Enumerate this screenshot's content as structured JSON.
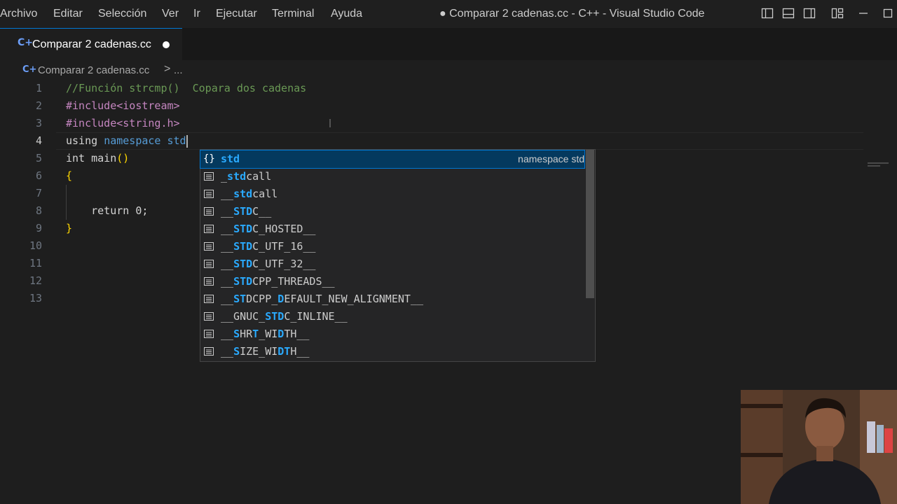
{
  "menubar": {
    "items": [
      "Archivo",
      "Editar",
      "Selección",
      "Ver",
      "Ir",
      "Ejecutar",
      "Terminal",
      "Ayuda"
    ],
    "title": "● Comparar 2 cadenas.cc - C++ - Visual Studio Code"
  },
  "tab": {
    "icon": "cpp-file-icon",
    "label": "Comparar 2 cadenas.cc",
    "unsaved": true
  },
  "breadcrumb": {
    "file": "Comparar 2 cadenas.cc",
    "separator": ">",
    "rest": "..."
  },
  "editor": {
    "line_numbers": [
      "1",
      "2",
      "3",
      "4",
      "5",
      "6",
      "7",
      "8",
      "9",
      "10",
      "11",
      "12",
      "13"
    ],
    "active_line": 4,
    "lines": [
      "//Función strcmp()  Copara dos cadenas",
      "#include<iostream>",
      "#include<string.h>",
      "using namespace std",
      "int main()",
      "{",
      "",
      "    return 0;",
      "}"
    ]
  },
  "suggest": {
    "items": [
      {
        "pre": "",
        "match": "std",
        "post": "",
        "kind": "namespace",
        "detail": "namespace std",
        "selected": true
      },
      {
        "pre": "_",
        "match": "std",
        "post": "call",
        "kind": "text"
      },
      {
        "pre": "__",
        "match": "std",
        "post": "call",
        "kind": "text"
      },
      {
        "pre": "__",
        "match": "STD",
        "post": "C__",
        "kind": "text"
      },
      {
        "pre": "__",
        "match": "STD",
        "post": "C_HOSTED__",
        "kind": "text"
      },
      {
        "pre": "__",
        "match": "STD",
        "post": "C_UTF_16__",
        "kind": "text"
      },
      {
        "pre": "__",
        "match": "STD",
        "post": "C_UTF_32__",
        "kind": "text"
      },
      {
        "pre": "__",
        "match": "STD",
        "post": "CPP_THREADS__",
        "kind": "text"
      },
      {
        "pre": "__",
        "match": "ST",
        "post": "DCPP_",
        "match2": "D",
        "post2": "EFAULT_NEW_ALIGNMENT__",
        "kind": "text"
      },
      {
        "pre": "__GNUC_",
        "match": "STD",
        "post": "C_INLINE__",
        "kind": "text"
      },
      {
        "pre": "__",
        "match": "S",
        "post": "HR",
        "match2": "T",
        "post2": "_WI",
        "match3": "D",
        "post3": "TH__",
        "kind": "text"
      },
      {
        "pre": "__",
        "match": "S",
        "post": "IZE_WI",
        "match2": "DT",
        "post2": "H__",
        "kind": "text"
      }
    ]
  },
  "colors": {
    "accent": "#0078d4",
    "comment": "#6a9955",
    "preprocessor": "#c586c0",
    "keyword": "#569cd6",
    "match": "#2aaaff"
  }
}
